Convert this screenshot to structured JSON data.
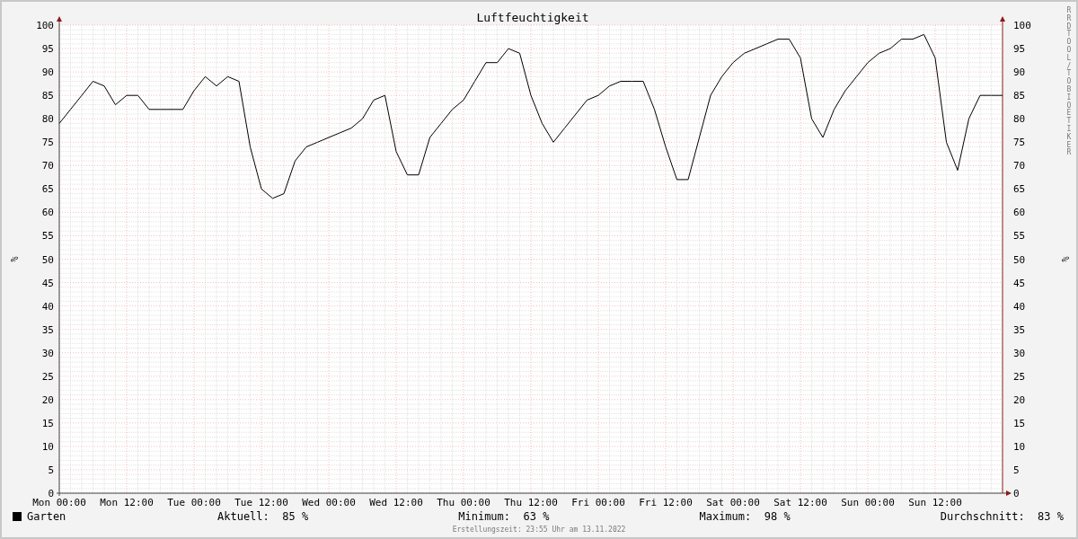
{
  "chart_data": {
    "type": "line",
    "title": "Luftfeuchtigkeit",
    "ylabel": "%",
    "ylim": [
      0,
      100
    ],
    "grid": true,
    "categories": [
      "Mon 00:00",
      null,
      null,
      null,
      null,
      null,
      "Mon 12:00",
      null,
      null,
      null,
      null,
      null,
      "Tue 00:00",
      null,
      null,
      null,
      null,
      null,
      "Tue 12:00",
      null,
      null,
      null,
      null,
      null,
      "Wed 00:00",
      null,
      null,
      null,
      null,
      null,
      "Wed 12:00",
      null,
      null,
      null,
      null,
      null,
      "Thu 00:00",
      null,
      null,
      null,
      null,
      null,
      "Thu 12:00",
      null,
      null,
      null,
      null,
      null,
      "Fri 00:00",
      null,
      null,
      null,
      null,
      null,
      "Fri 12:00",
      null,
      null,
      null,
      null,
      null,
      "Sat 00:00",
      null,
      null,
      null,
      null,
      null,
      "Sat 12:00",
      null,
      null,
      null,
      null,
      null,
      "Sun 00:00",
      null,
      null,
      null,
      null,
      null,
      "Sun 12:00",
      null,
      null,
      null,
      null,
      null,
      null
    ],
    "series": [
      {
        "name": "Garten",
        "color": "#000000",
        "values": [
          79,
          82,
          85,
          88,
          87,
          83,
          85,
          85,
          82,
          82,
          82,
          82,
          86,
          89,
          87,
          89,
          88,
          74,
          65,
          63,
          64,
          71,
          74,
          75,
          76,
          77,
          78,
          80,
          84,
          85,
          73,
          68,
          68,
          76,
          79,
          82,
          84,
          88,
          92,
          92,
          95,
          94,
          85,
          79,
          75,
          78,
          81,
          84,
          85,
          87,
          88,
          88,
          88,
          82,
          74,
          67,
          67,
          76,
          85,
          89,
          92,
          94,
          95,
          96,
          97,
          97,
          93,
          80,
          76,
          82,
          86,
          89,
          92,
          94,
          95,
          97,
          97,
          98,
          93,
          75,
          69,
          80,
          85,
          85,
          85
        ]
      }
    ],
    "yticks": [
      0,
      5,
      10,
      15,
      20,
      25,
      30,
      35,
      40,
      45,
      50,
      55,
      60,
      65,
      70,
      75,
      80,
      85,
      90,
      95,
      100
    ]
  },
  "right_axis": {
    "unit": "%",
    "ticks": [
      "100",
      "95",
      "90",
      "85",
      "80",
      "75",
      "70",
      "65",
      "60",
      "55",
      "50",
      "45",
      "40",
      "35",
      "30",
      "25",
      "20",
      "15",
      "10",
      "5",
      "0"
    ]
  },
  "credit": "RRDTOOL / TOBI OETIKER",
  "legend": {
    "stats": [
      {
        "label": "Aktuell:",
        "value": "85 %"
      },
      {
        "label": "Minimum:",
        "value": "63 %"
      },
      {
        "label": "Maximum:",
        "value": "98 %"
      },
      {
        "label": "Durchschnitt:",
        "value": "83 %"
      }
    ]
  },
  "footer": "Erstellungszeit: 23:55 Uhr am 13.11.2022"
}
